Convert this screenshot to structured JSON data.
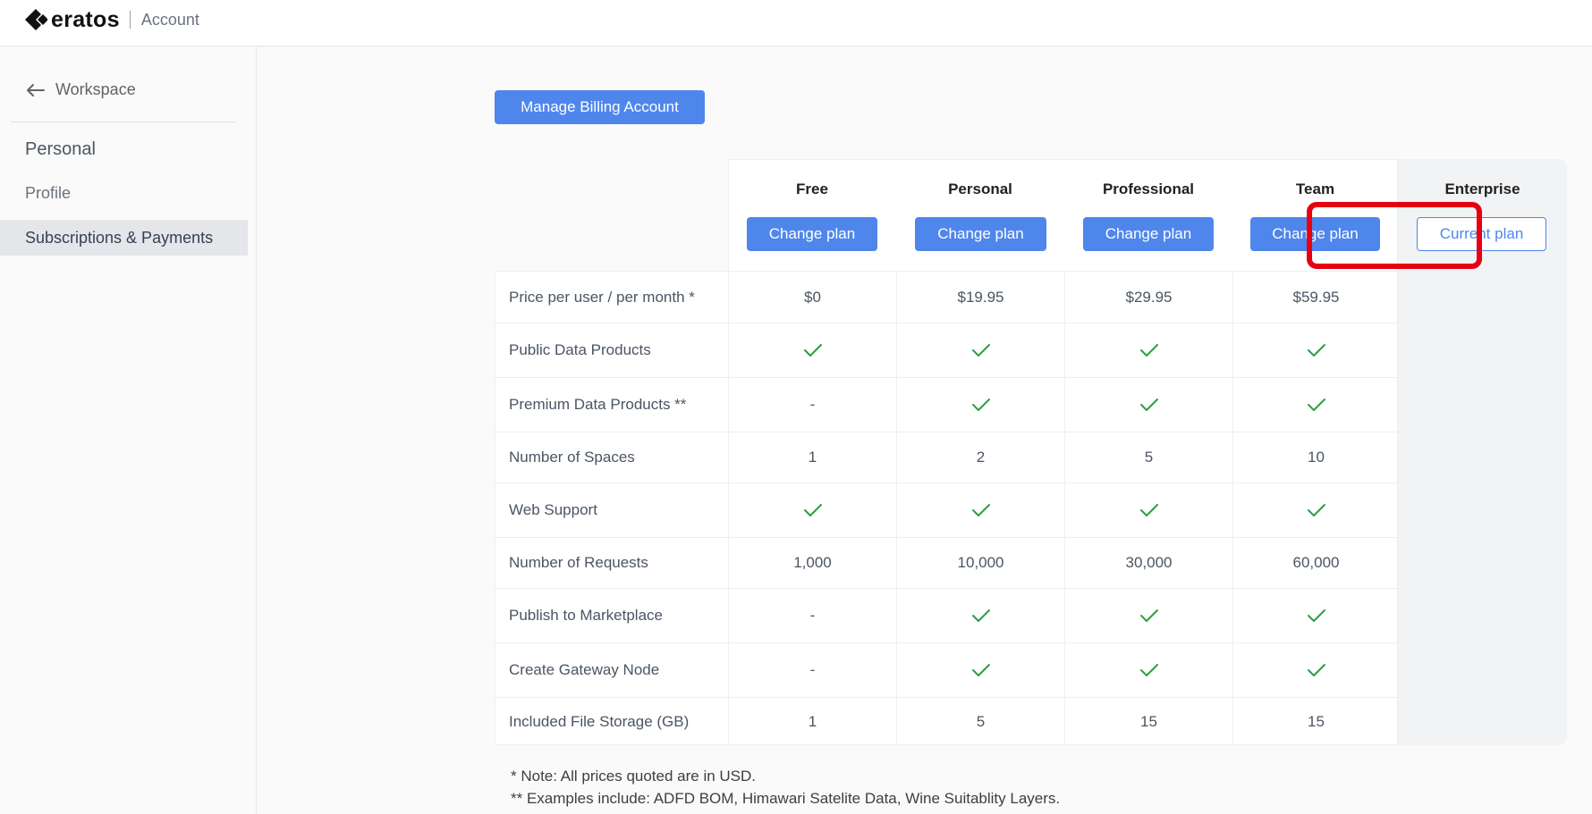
{
  "header": {
    "brand": "eratos",
    "section": "Account",
    "logo_icon": "eratos-chevron-logo"
  },
  "sidebar": {
    "back_label": "Workspace",
    "title": "Personal",
    "items": [
      {
        "label": "Profile",
        "active": false
      },
      {
        "label": "Subscriptions & Payments",
        "active": true
      }
    ]
  },
  "main": {
    "billing_button": "Manage Billing Account",
    "plans": [
      {
        "name": "Free",
        "button": "Change plan",
        "style": "primary"
      },
      {
        "name": "Personal",
        "button": "Change plan",
        "style": "primary"
      },
      {
        "name": "Professional",
        "button": "Change plan",
        "style": "primary",
        "highlighted": true
      },
      {
        "name": "Team",
        "button": "Change plan",
        "style": "primary"
      },
      {
        "name": "Enterprise",
        "button": "Current plan",
        "style": "outline"
      }
    ],
    "features": [
      {
        "label": "Price per user / per month *",
        "values": [
          "$0",
          "$19.95",
          "$29.95",
          "$59.95"
        ]
      },
      {
        "label": "Public Data Products",
        "values": [
          "check",
          "check",
          "check",
          "check"
        ]
      },
      {
        "label": "Premium Data Products **",
        "values": [
          "-",
          "check",
          "check",
          "check"
        ]
      },
      {
        "label": "Number of Spaces",
        "values": [
          "1",
          "2",
          "5",
          "10"
        ]
      },
      {
        "label": "Web Support",
        "values": [
          "check",
          "check",
          "check",
          "check"
        ]
      },
      {
        "label": "Number of Requests",
        "values": [
          "1,000",
          "10,000",
          "30,000",
          "60,000"
        ]
      },
      {
        "label": "Publish to Marketplace",
        "values": [
          "-",
          "check",
          "check",
          "check"
        ]
      },
      {
        "label": "Create Gateway Node",
        "values": [
          "-",
          "check",
          "check",
          "check"
        ]
      },
      {
        "label": "Included File Storage (GB)",
        "values": [
          "1",
          "5",
          "15",
          "15"
        ]
      }
    ],
    "notes": [
      "* Note: All prices quoted are in USD.",
      "** Examples include: ADFD BOM, Himawari Satelite Data, Wine Suitablity Layers."
    ]
  },
  "colors": {
    "accent": "#4f86ec",
    "check": "#2e9e3f",
    "highlight": "#e60012"
  }
}
